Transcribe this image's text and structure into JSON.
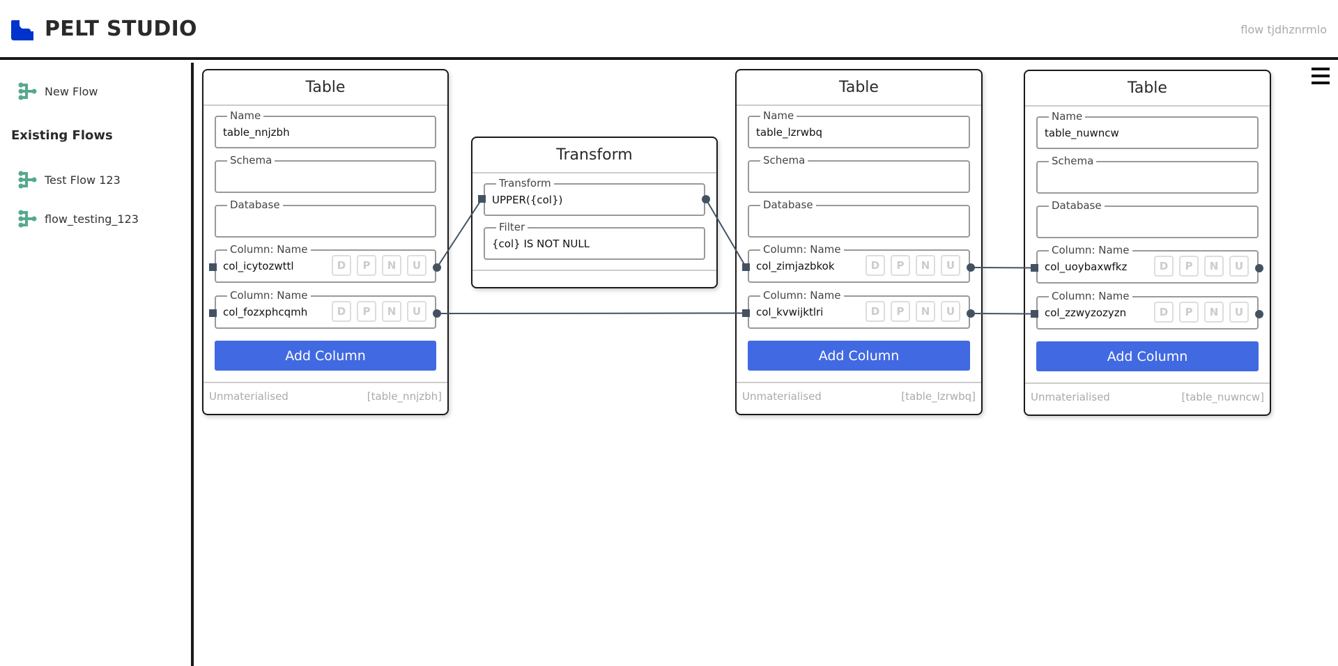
{
  "header": {
    "app_title": "PELT STUDIO",
    "flow_name": "flow tjdhznrmlo",
    "logo_color": "#0033cc"
  },
  "sidebar": {
    "new_flow_label": "New Flow",
    "existing_heading": "Existing Flows",
    "flows": [
      {
        "label": "Test Flow 123",
        "icon": "flow-tree-icon"
      },
      {
        "label": "flow_testing_123",
        "icon": "flow-tree-icon"
      }
    ],
    "icon_color": "#55aa8b"
  },
  "menu": {
    "icon": "hamburger-menu-icon"
  },
  "nodes": {
    "table1": {
      "title": "Table",
      "name_label": "Name",
      "name_value": "table_nnjzbh",
      "schema_label": "Schema",
      "schema_value": "",
      "database_label": "Database",
      "database_value": "",
      "columns": [
        {
          "label": "Column: Name",
          "value": "col_icytozwttl"
        },
        {
          "label": "Column: Name",
          "value": "col_fozxphcqmh"
        }
      ],
      "flags": [
        "D",
        "P",
        "N",
        "U"
      ],
      "add_column_label": "Add Column",
      "status": "Unmaterialised",
      "ref": "[table_nnjzbh]"
    },
    "transform": {
      "title": "Transform",
      "transform_label": "Transform",
      "transform_value": "UPPER({col})",
      "filter_label": "Filter",
      "filter_value": "{col} IS NOT NULL"
    },
    "table2": {
      "title": "Table",
      "name_label": "Name",
      "name_value": "table_lzrwbq",
      "schema_label": "Schema",
      "schema_value": "",
      "database_label": "Database",
      "database_value": "",
      "columns": [
        {
          "label": "Column: Name",
          "value": "col_zimjazbkok"
        },
        {
          "label": "Column: Name",
          "value": "col_kvwijktlri"
        }
      ],
      "flags": [
        "D",
        "P",
        "N",
        "U"
      ],
      "add_column_label": "Add Column",
      "status": "Unmaterialised",
      "ref": "[table_lzrwbq]"
    },
    "table3": {
      "title": "Table",
      "name_label": "Name",
      "name_value": "table_nuwncw",
      "schema_label": "Schema",
      "schema_value": "",
      "database_label": "Database",
      "database_value": "",
      "columns": [
        {
          "label": "Column: Name",
          "value": "col_uoybaxwfkz"
        },
        {
          "label": "Column: Name",
          "value": "col_zzwyzozyzn"
        }
      ],
      "flags": [
        "D",
        "P",
        "N",
        "U"
      ],
      "add_column_label": "Add Column",
      "status": "Unmaterialised",
      "ref": "[table_nuwncw]"
    }
  },
  "edges": [
    {
      "from": "table1.columns.0",
      "to": "transform.transform"
    },
    {
      "from": "transform.transform",
      "to": "table2.columns.0"
    },
    {
      "from": "table1.columns.1",
      "to": "table2.columns.1"
    },
    {
      "from": "table2.columns.0",
      "to": "table3.columns.0"
    },
    {
      "from": "table2.columns.1",
      "to": "table3.columns.1"
    }
  ],
  "colors": {
    "accent": "#4169e1",
    "handle": "#435263",
    "edge": "#435263"
  }
}
